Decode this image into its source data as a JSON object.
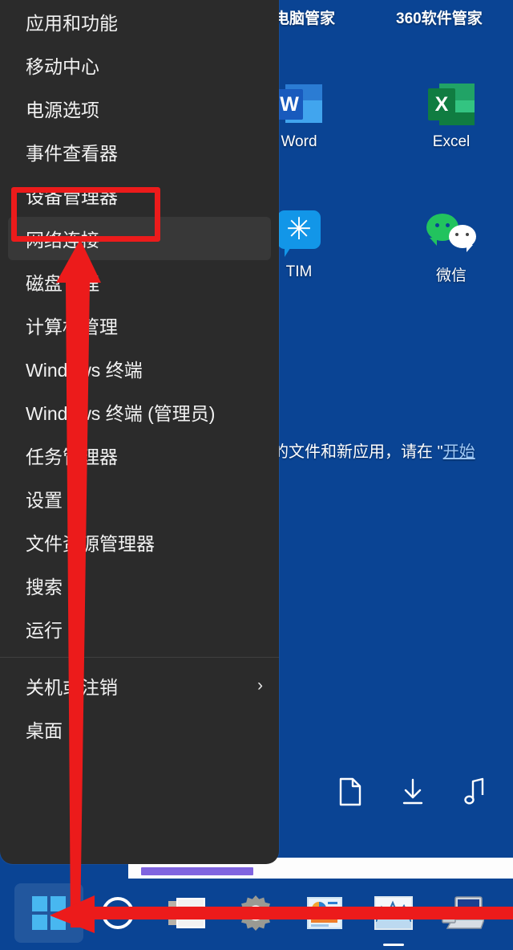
{
  "desktop": {
    "background_color": "#0a4494",
    "top_labels": [
      {
        "text": "电脑管家"
      },
      {
        "text": "360软件管家"
      }
    ],
    "icons": [
      {
        "name": "word",
        "caption": "Word",
        "letter": "W",
        "color": "#185abd"
      },
      {
        "name": "excel",
        "caption": "Excel",
        "letter": "X",
        "color": "#107c41"
      },
      {
        "name": "tim",
        "caption": "TIM",
        "letter": "✳",
        "color": "#1296e8"
      },
      {
        "name": "wechat",
        "caption": "微信",
        "color": "#22c35e"
      }
    ],
    "notice_text_prefix": "的文件和新应用，请在 \"",
    "notice_link": "开始",
    "mini_icons": [
      {
        "name": "document-icon"
      },
      {
        "name": "download-icon"
      },
      {
        "name": "music-note-icon"
      }
    ]
  },
  "context_menu": {
    "background_color": "#2b2b2b",
    "highlight_color": "#383838",
    "items": [
      {
        "label": "应用和功能",
        "highlighted": false,
        "chevron": ""
      },
      {
        "label": "移动中心",
        "highlighted": false,
        "chevron": ""
      },
      {
        "label": "电源选项",
        "highlighted": false,
        "chevron": ""
      },
      {
        "label": "事件查看器",
        "highlighted": false,
        "chevron": ""
      },
      {
        "label": "设备管理器",
        "highlighted": false,
        "chevron": ""
      },
      {
        "label": "网络连接",
        "highlighted": true,
        "chevron": ""
      },
      {
        "label": "磁盘管理",
        "highlighted": false,
        "chevron": ""
      },
      {
        "label": "计算机管理",
        "highlighted": false,
        "chevron": ""
      },
      {
        "label": "Windows 终端",
        "highlighted": false,
        "chevron": ""
      },
      {
        "label": "Windows 终端 (管理员)",
        "highlighted": false,
        "chevron": ""
      },
      {
        "label": "任务管理器",
        "highlighted": false,
        "chevron": ""
      },
      {
        "label": "设置",
        "highlighted": false,
        "chevron": ""
      },
      {
        "label": "文件资源管理器",
        "highlighted": false,
        "chevron": ""
      },
      {
        "label": "搜索",
        "highlighted": false,
        "chevron": ""
      },
      {
        "label": "运行",
        "highlighted": false,
        "chevron": ""
      },
      {
        "label": "关机或注销",
        "highlighted": false,
        "chevron": "›",
        "separator_above": true
      },
      {
        "label": "桌面",
        "highlighted": false,
        "chevron": ""
      }
    ]
  },
  "taskbar": {
    "background_color": "#0a4494",
    "items": [
      {
        "name": "start-button",
        "icon": "windows-logo-icon",
        "active": true
      },
      {
        "name": "search-button",
        "icon": "search-circle-icon",
        "active": false
      },
      {
        "name": "task-view-button",
        "icon": "task-view-icon",
        "active": false
      },
      {
        "name": "settings-button",
        "icon": "gear-icon",
        "active": false
      },
      {
        "name": "app-button-1",
        "icon": "app-tile-icon",
        "active": false
      },
      {
        "name": "app-button-2",
        "icon": "chart-graph-icon",
        "active": true
      },
      {
        "name": "app-button-3",
        "icon": "computer-icon",
        "active": false
      }
    ]
  },
  "annotations": {
    "highlight_color": "#ec1b1b",
    "rect_target": "设备管理器",
    "arrow_vertical": "points from start button up to 设备管理器",
    "arrow_horizontal": "points left to the start button"
  }
}
